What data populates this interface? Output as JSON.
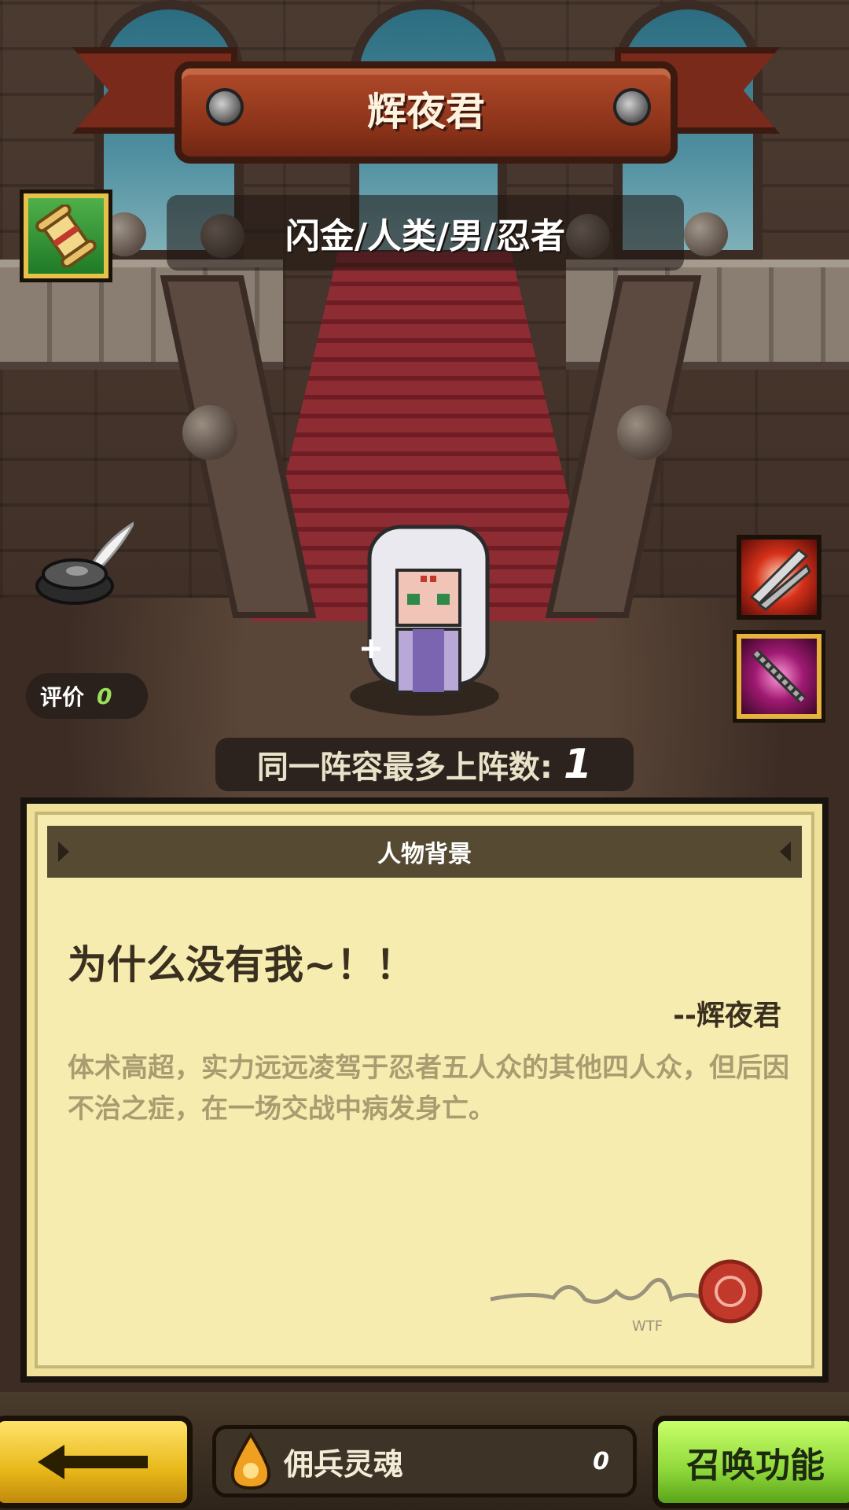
{
  "hero": {
    "name": "辉夜君",
    "attributes": "闪金/人类/男/忍者"
  },
  "rating": {
    "label": "评价",
    "value": "0"
  },
  "deploy": {
    "label": "同一阵容最多上阵数:",
    "value": "1"
  },
  "background_panel": {
    "header": "人物背景",
    "quote": "为什么没有我~！！",
    "quote_author": "--辉夜君",
    "story": "体术高超，实力远远凌驾于忍者五人众的其他四人众，但后因不治之症，在一场交战中病发身亡。",
    "signature_mark": "WTF"
  },
  "bottom_bar": {
    "soul_label": "佣兵灵魂",
    "soul_count": "0",
    "summon_label": "召唤功能"
  },
  "icons": {
    "scroll": "scroll-icon",
    "quill": "quill-inkwell-icon",
    "skill_1": "blade-slash-skill-icon",
    "skill_2": "spiked-spear-skill-icon",
    "back": "left-arrow-icon",
    "soul": "soul-drop-icon"
  },
  "colors": {
    "banner": "#8a3219",
    "panel": "#f7ecb0",
    "summon_button": "#8fd83a",
    "back_button": "#e8b81a",
    "rating_value": "#9be05a"
  }
}
